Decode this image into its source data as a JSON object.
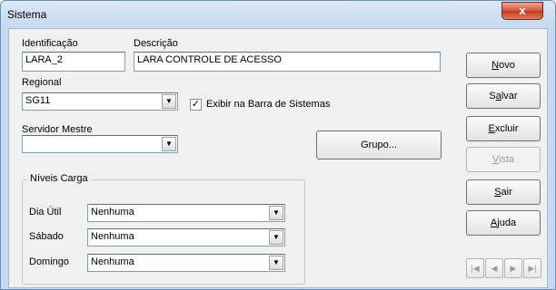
{
  "window": {
    "title": "Sistema",
    "close_glyph": "x"
  },
  "fields": {
    "identificacao": {
      "label": "Identificação",
      "value": "LARA_2"
    },
    "descricao": {
      "label": "Descrição",
      "value": "LARA CONTROLE DE ACESSO"
    },
    "regional": {
      "label": "Regional",
      "value": "SG11"
    },
    "exibir": {
      "label": "Exibir na Barra de Sistemas",
      "checked": true
    },
    "servidor": {
      "label": "Servidor Mestre",
      "value": ""
    }
  },
  "grupo_button": {
    "label": "Grupo..."
  },
  "niveis": {
    "title": "Níveis Carga",
    "rows": [
      {
        "label": "Dia Útil",
        "value": "Nenhuma"
      },
      {
        "label": "Sábado",
        "value": "Nenhuma"
      },
      {
        "label": "Domingo",
        "value": "Nenhuma"
      }
    ]
  },
  "buttons": {
    "novo": {
      "pre": "",
      "key": "N",
      "post": "ovo",
      "enabled": true
    },
    "salvar": {
      "pre": "S",
      "key": "a",
      "post": "lvar",
      "enabled": true
    },
    "excluir": {
      "pre": "",
      "key": "E",
      "post": "xcluir",
      "enabled": true
    },
    "vista": {
      "pre": "",
      "key": "V",
      "post": "ista",
      "enabled": false
    },
    "sair": {
      "pre": "",
      "key": "S",
      "post": "air",
      "enabled": true
    },
    "ajuda": {
      "pre": "",
      "key": "A",
      "post": "juda",
      "enabled": true
    }
  },
  "navigator": {
    "first": "|◀",
    "prev": "◀",
    "next": "▶",
    "last": "▶|"
  },
  "icons": {
    "dropdown": "chevron-down-icon",
    "close": "close-icon",
    "check": "checkmark-icon"
  }
}
